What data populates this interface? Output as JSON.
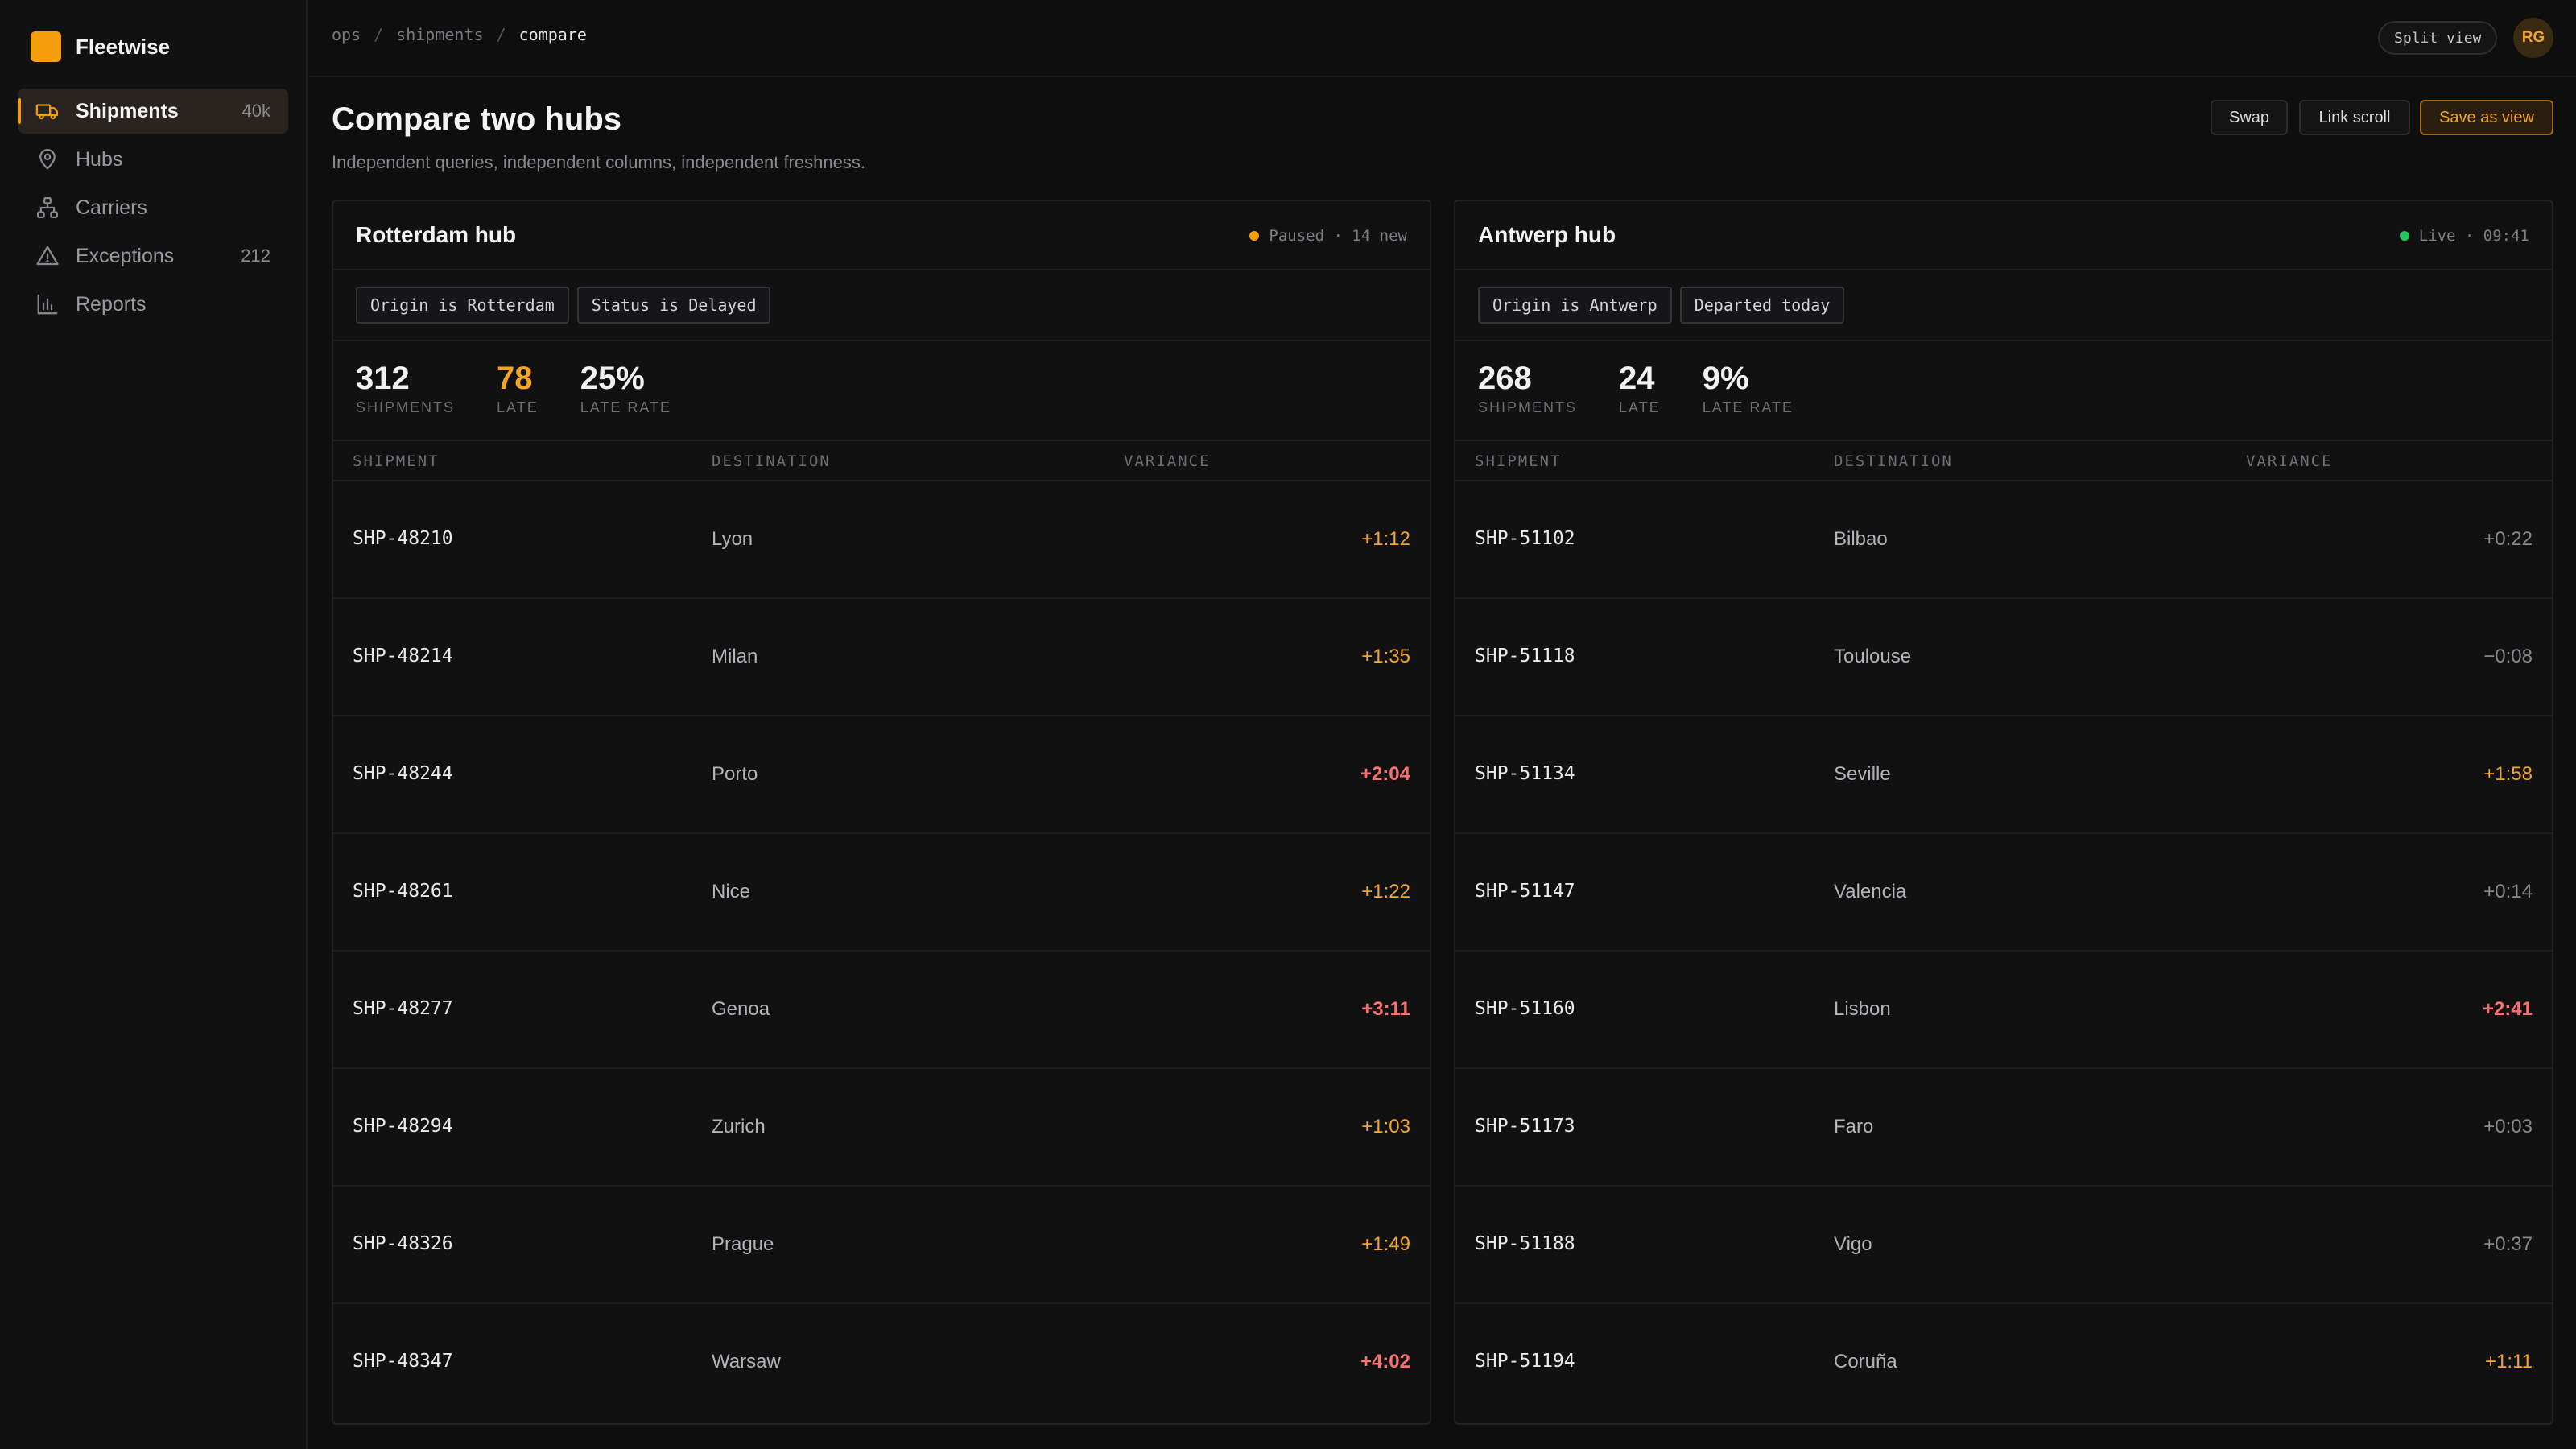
{
  "app": {
    "name": "Fleetwise"
  },
  "sidebar": {
    "items": [
      {
        "label": "Shipments",
        "count": "40k",
        "icon": "truck-icon",
        "active": true
      },
      {
        "label": "Hubs",
        "count": "",
        "icon": "map-pin-icon",
        "active": false
      },
      {
        "label": "Carriers",
        "count": "",
        "icon": "network-icon",
        "active": false
      },
      {
        "label": "Exceptions",
        "count": "212",
        "icon": "alert-triangle-icon",
        "active": false
      },
      {
        "label": "Reports",
        "count": "",
        "icon": "bar-chart-icon",
        "active": false
      }
    ]
  },
  "topbar": {
    "breadcrumb": [
      "ops",
      "shipments",
      "compare"
    ],
    "split_view_label": "Split view",
    "avatar_initials": "RG"
  },
  "header": {
    "title": "Compare two hubs",
    "subtitle": "Independent queries, independent columns, independent freshness.",
    "swap_label": "Swap",
    "link_scroll_label": "Link scroll",
    "save_view_label": "Save as view"
  },
  "colors": {
    "accent": "#f59e0b",
    "late": "#f87171",
    "live": "#22c55e"
  },
  "panels": [
    {
      "title": "Rotterdam hub",
      "status_text": "Paused · 14 new",
      "status_color": "#f59e0b",
      "filters": [
        "Origin is Rotterdam",
        "Status is Delayed"
      ],
      "stats": [
        {
          "value": "312",
          "label": "SHIPMENTS",
          "highlight": false
        },
        {
          "value": "78",
          "label": "LATE",
          "highlight": true
        },
        {
          "value": "25%",
          "label": "LATE RATE",
          "highlight": false
        }
      ],
      "columns": [
        "SHIPMENT",
        "DESTINATION",
        "VARIANCE"
      ],
      "rows": [
        {
          "shipment": "SHP-48210",
          "destination": "Lyon",
          "variance": "+1:12",
          "tone": "amber"
        },
        {
          "shipment": "SHP-48214",
          "destination": "Milan",
          "variance": "+1:35",
          "tone": "amber"
        },
        {
          "shipment": "SHP-48244",
          "destination": "Porto",
          "variance": "+2:04",
          "tone": "red"
        },
        {
          "shipment": "SHP-48261",
          "destination": "Nice",
          "variance": "+1:22",
          "tone": "amber"
        },
        {
          "shipment": "SHP-48277",
          "destination": "Genoa",
          "variance": "+3:11",
          "tone": "red"
        },
        {
          "shipment": "SHP-48294",
          "destination": "Zurich",
          "variance": "+1:03",
          "tone": "amber"
        },
        {
          "shipment": "SHP-48326",
          "destination": "Prague",
          "variance": "+1:49",
          "tone": "amber"
        },
        {
          "shipment": "SHP-48347",
          "destination": "Warsaw",
          "variance": "+4:02",
          "tone": "red"
        }
      ]
    },
    {
      "title": "Antwerp hub",
      "status_text": "Live · 09:41",
      "status_color": "#22c55e",
      "filters": [
        "Origin is Antwerp",
        "Departed today"
      ],
      "stats": [
        {
          "value": "268",
          "label": "SHIPMENTS",
          "highlight": false
        },
        {
          "value": "24",
          "label": "LATE",
          "highlight": false
        },
        {
          "value": "9%",
          "label": "LATE RATE",
          "highlight": false
        }
      ],
      "columns": [
        "SHIPMENT",
        "DESTINATION",
        "VARIANCE"
      ],
      "rows": [
        {
          "shipment": "SHP-51102",
          "destination": "Bilbao",
          "variance": "+0:22",
          "tone": "grey"
        },
        {
          "shipment": "SHP-51118",
          "destination": "Toulouse",
          "variance": "−0:08",
          "tone": "grey"
        },
        {
          "shipment": "SHP-51134",
          "destination": "Seville",
          "variance": "+1:58",
          "tone": "amber"
        },
        {
          "shipment": "SHP-51147",
          "destination": "Valencia",
          "variance": "+0:14",
          "tone": "grey"
        },
        {
          "shipment": "SHP-51160",
          "destination": "Lisbon",
          "variance": "+2:41",
          "tone": "red"
        },
        {
          "shipment": "SHP-51173",
          "destination": "Faro",
          "variance": "+0:03",
          "tone": "grey"
        },
        {
          "shipment": "SHP-51188",
          "destination": "Vigo",
          "variance": "+0:37",
          "tone": "grey"
        },
        {
          "shipment": "SHP-51194",
          "destination": "Coruña",
          "variance": "+1:11",
          "tone": "amber"
        }
      ]
    }
  ]
}
